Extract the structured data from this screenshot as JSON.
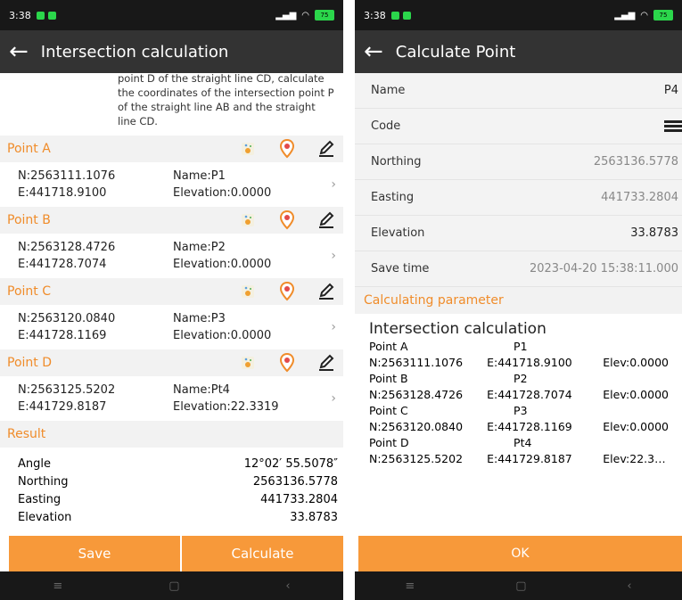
{
  "status": {
    "time": "3:38",
    "battery": "75"
  },
  "left": {
    "title": "Intersection calculation",
    "description": "point D of the straight line CD, calculate the coordinates of the intersection point P of the straight line AB and the straight line CD.",
    "points": [
      {
        "label": "Point A",
        "n": "N:2563111.1076",
        "e": "E:441718.9100",
        "name": "Name:P1",
        "elev": "Elevation:0.0000"
      },
      {
        "label": "Point B",
        "n": "N:2563128.4726",
        "e": "E:441728.7074",
        "name": "Name:P2",
        "elev": "Elevation:0.0000"
      },
      {
        "label": "Point C",
        "n": "N:2563120.0840",
        "e": "E:441728.1169",
        "name": "Name:P3",
        "elev": "Elevation:0.0000"
      },
      {
        "label": "Point D",
        "n": "N:2563125.5202",
        "e": "E:441729.8187",
        "name": "Name:Pt4",
        "elev": "Elevation:22.3319"
      }
    ],
    "result": {
      "label": "Result",
      "rows": [
        {
          "k": "Angle",
          "v": "12°02′ 55.5078″"
        },
        {
          "k": "Northing",
          "v": "2563136.5778"
        },
        {
          "k": "Easting",
          "v": "441733.2804"
        },
        {
          "k": "Elevation",
          "v": "33.8783"
        }
      ]
    },
    "save_label": "Save",
    "calculate_label": "Calculate"
  },
  "right": {
    "title": "Calculate Point",
    "fields": [
      {
        "k": "Name",
        "v": "P4"
      },
      {
        "k": "Code",
        "v": ""
      },
      {
        "k": "Northing",
        "v": "2563136.5778"
      },
      {
        "k": "Easting",
        "v": "441733.2804"
      },
      {
        "k": "Elevation",
        "v": "33.8783"
      },
      {
        "k": "Save time",
        "v": "2023-04-20 15:38:11.000"
      }
    ],
    "param_header": "Calculating parameter",
    "param_title": "Intersection calculation",
    "param_lines": [
      {
        "a": "Point A",
        "b": "P1",
        "c": ""
      },
      {
        "a": "N:2563111.1076",
        "b": "E:441718.9100",
        "c": "Elev:0.0000"
      },
      {
        "a": "Point B",
        "b": "P2",
        "c": ""
      },
      {
        "a": "N:2563128.4726",
        "b": "E:441728.7074",
        "c": "Elev:0.0000"
      },
      {
        "a": "Point C",
        "b": "P3",
        "c": ""
      },
      {
        "a": "N:2563120.0840",
        "b": "E:441728.1169",
        "c": "Elev:0.0000"
      },
      {
        "a": "Point D",
        "b": "Pt4",
        "c": ""
      },
      {
        "a": "N:2563125.5202",
        "b": "E:441729.8187",
        "c": "Elev:22.3…"
      }
    ],
    "ok_label": "OK"
  },
  "icons": {
    "map_pick": "map-pick-icon",
    "location": "location-pin-icon",
    "edit": "edit-icon",
    "code_list": "code-list-icon"
  },
  "colors": {
    "accent": "#f08c2a",
    "button": "#f7993a",
    "appbar": "#333333"
  }
}
